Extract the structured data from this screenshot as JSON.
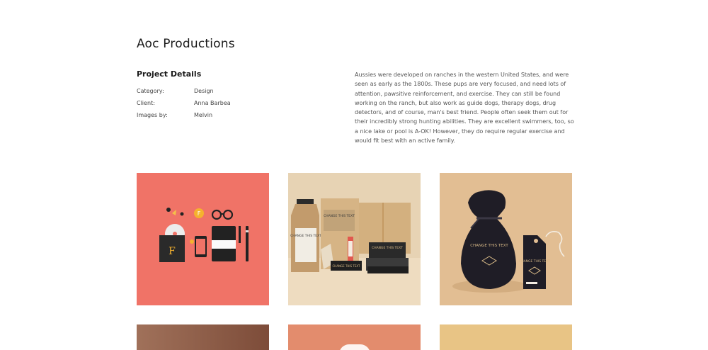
{
  "project": {
    "title": "Aoc Productions",
    "details_heading": "Project Details",
    "details": [
      {
        "label": "Category:",
        "value": "Design"
      },
      {
        "label": "Client:",
        "value": "Anna Barbea"
      },
      {
        "label": "Images by:",
        "value": "Melvin"
      }
    ],
    "description": "Aussies were developed on ranches in the western United States, and were seen as early as the 1800s. These pups are very focused, and need lots of attention, pawsitive reinforcement, and exercise. They can still be found working on the ranch, but also work as guide dogs, therapy dogs, drug detectors, and of course, man's best friend. People often seek them out for their incredibly strong hunting abilities. They are excellent swimmers, too, so a nice lake or pool is A-OK! However, they do require regular exercise and would fit best with an active family."
  },
  "gallery": {
    "mockup_text": "CHANGE THIS TEXT",
    "brand_letter": "F",
    "colors": {
      "tile1": "#f07367",
      "tile2": "#e7d3b4",
      "tile3": "#e2be93",
      "tile4": "#8f5e48",
      "tile5": "#e38c6d",
      "tile6": "#e8c485"
    }
  }
}
